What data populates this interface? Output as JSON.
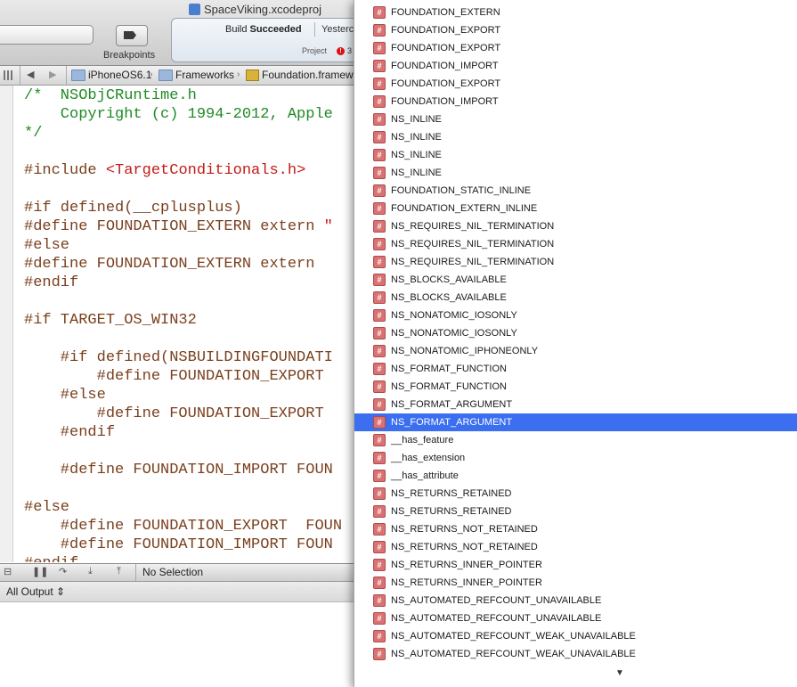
{
  "window": {
    "title": "SpaceViking.xcodeproj"
  },
  "toolbar": {
    "breakpoints_label": "Breakpoints",
    "build_status_prefix": "Build",
    "build_status_bold": "Succeeded",
    "build_time": "Yesterc",
    "project_label": "Project",
    "error_count": "3"
  },
  "jumpbar": {
    "crumbs": [
      "iPhoneOS6.1",
      "Frameworks",
      "Foundation.framew"
    ]
  },
  "editor": {
    "lines": [
      [
        {
          "t": "/*  NSObjCRuntime.h",
          "c": "comment"
        }
      ],
      [
        {
          "t": "    Copyright (c) 1994-2012, Apple",
          "c": "comment"
        }
      ],
      [
        {
          "t": "*/",
          "c": "comment"
        }
      ],
      [],
      [
        {
          "t": "#include ",
          "c": "pre"
        },
        {
          "t": "<TargetConditionals.h>",
          "c": "str"
        }
      ],
      [],
      [
        {
          "t": "#if defined(__cplusplus)",
          "c": "pre"
        }
      ],
      [
        {
          "t": "#define FOUNDATION_EXTERN extern ",
          "c": "pre"
        },
        {
          "t": "\"",
          "c": "str"
        }
      ],
      [
        {
          "t": "#else",
          "c": "pre"
        }
      ],
      [
        {
          "t": "#define FOUNDATION_EXTERN extern",
          "c": "pre"
        }
      ],
      [
        {
          "t": "#endif",
          "c": "pre"
        }
      ],
      [],
      [
        {
          "t": "#if TARGET_OS_WIN32",
          "c": "pre"
        }
      ],
      [],
      [
        {
          "t": "    #if defined(NSBUILDINGFOUNDATI",
          "c": "pre"
        }
      ],
      [
        {
          "t": "        #define FOUNDATION_EXPORT",
          "c": "pre"
        }
      ],
      [
        {
          "t": "    #else",
          "c": "pre"
        }
      ],
      [
        {
          "t": "        #define FOUNDATION_EXPORT",
          "c": "pre"
        }
      ],
      [
        {
          "t": "    #endif",
          "c": "pre"
        }
      ],
      [],
      [
        {
          "t": "    #define FOUNDATION_IMPORT FOUN",
          "c": "pre"
        }
      ],
      [],
      [
        {
          "t": "#else",
          "c": "pre"
        }
      ],
      [
        {
          "t": "    #define FOUNDATION_EXPORT  FOUN",
          "c": "pre"
        }
      ],
      [
        {
          "t": "    #define FOUNDATION_IMPORT FOUN",
          "c": "pre"
        }
      ],
      [
        {
          "t": "#endif",
          "c": "pre"
        }
      ]
    ]
  },
  "debug": {
    "selection_label": "No Selection"
  },
  "console": {
    "output_filter": "All Output"
  },
  "completion": {
    "badge_glyph": "#",
    "selected_index": 23,
    "items": [
      "FOUNDATION_EXTERN",
      "FOUNDATION_EXPORT",
      "FOUNDATION_EXPORT",
      "FOUNDATION_IMPORT",
      "FOUNDATION_EXPORT",
      "FOUNDATION_IMPORT",
      "NS_INLINE",
      "NS_INLINE",
      "NS_INLINE",
      "NS_INLINE",
      "FOUNDATION_STATIC_INLINE",
      "FOUNDATION_EXTERN_INLINE",
      "NS_REQUIRES_NIL_TERMINATION",
      "NS_REQUIRES_NIL_TERMINATION",
      "NS_REQUIRES_NIL_TERMINATION",
      "NS_BLOCKS_AVAILABLE",
      "NS_BLOCKS_AVAILABLE",
      "NS_NONATOMIC_IOSONLY",
      "NS_NONATOMIC_IOSONLY",
      "NS_NONATOMIC_IPHONEONLY",
      "NS_FORMAT_FUNCTION",
      "NS_FORMAT_FUNCTION",
      "NS_FORMAT_ARGUMENT",
      "NS_FORMAT_ARGUMENT",
      "__has_feature",
      "__has_extension",
      "__has_attribute",
      "NS_RETURNS_RETAINED",
      "NS_RETURNS_RETAINED",
      "NS_RETURNS_NOT_RETAINED",
      "NS_RETURNS_NOT_RETAINED",
      "NS_RETURNS_INNER_POINTER",
      "NS_RETURNS_INNER_POINTER",
      "NS_AUTOMATED_REFCOUNT_UNAVAILABLE",
      "NS_AUTOMATED_REFCOUNT_UNAVAILABLE",
      "NS_AUTOMATED_REFCOUNT_WEAK_UNAVAILABLE",
      "NS_AUTOMATED_REFCOUNT_WEAK_UNAVAILABLE"
    ]
  }
}
